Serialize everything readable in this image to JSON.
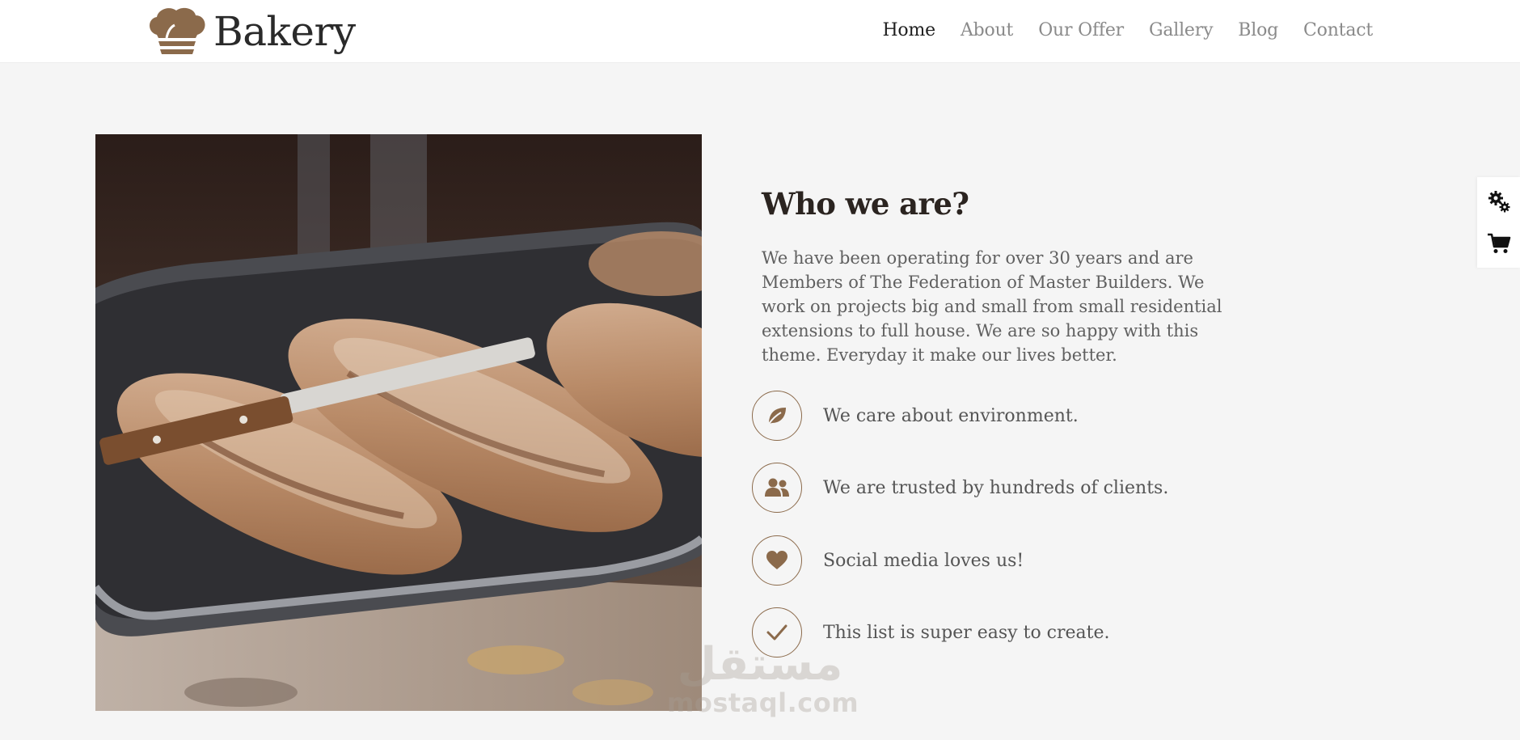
{
  "brand": {
    "name": "Bakery",
    "logo_icon": "chef-hat-icon",
    "accent_color": "#8b6a4b"
  },
  "nav": {
    "items": [
      {
        "label": "Home",
        "active": true
      },
      {
        "label": "About",
        "active": false
      },
      {
        "label": "Our Offer",
        "active": false
      },
      {
        "label": "Gallery",
        "active": false
      },
      {
        "label": "Blog",
        "active": false
      },
      {
        "label": "Contact",
        "active": false
      }
    ]
  },
  "about": {
    "title": "Who we are?",
    "description": "We have been operating for over 30 years and are Members of The Federation of Master Builders. We work on projects big and small from small residential extensions to full house. We are so happy with this theme. Everyday it make our lives better.",
    "features": [
      {
        "icon": "leaf-icon",
        "text": "We care about environment."
      },
      {
        "icon": "users-icon",
        "text": "We are trusted by hundreds of clients."
      },
      {
        "icon": "heart-icon",
        "text": "Social media loves us!"
      },
      {
        "icon": "check-icon",
        "text": "This list is super easy to create."
      }
    ]
  },
  "side_widget": {
    "buttons": [
      "settings-gears-icon",
      "shopping-cart-icon"
    ]
  },
  "watermark": {
    "arabic": "مستقل",
    "latin": "mostaql.com"
  }
}
